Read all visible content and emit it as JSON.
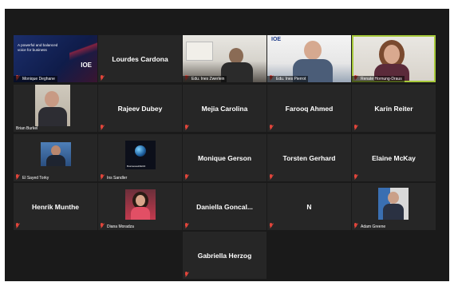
{
  "tiles": [
    {
      "kind": "slide",
      "slide_text": "A powerful and balanced voice for business",
      "slide_logo": "IOE",
      "label": "Monique Deghane"
    },
    {
      "kind": "name",
      "name": "Lourdes Cardona"
    },
    {
      "kind": "video",
      "label": "Edu. Ines Zwerlein"
    },
    {
      "kind": "video",
      "logo": "IOE",
      "label": "Edu. Ines Pierrot"
    },
    {
      "kind": "video",
      "label": "Renate Hornung-Draus",
      "active": true
    },
    {
      "kind": "video",
      "label": "Brian Burkel"
    },
    {
      "kind": "name",
      "name": "Rajeev Dubey"
    },
    {
      "kind": "name",
      "name": "Mejia Carolina"
    },
    {
      "kind": "name",
      "name": "Farooq Ahmed"
    },
    {
      "kind": "name",
      "name": "Karin Reiter"
    },
    {
      "kind": "video",
      "label": "El Sayed Torky"
    },
    {
      "kind": "video",
      "thumb_text": "BusinessatOECD",
      "label": "Ins Sandler"
    },
    {
      "kind": "name",
      "name": "Monique Gerson"
    },
    {
      "kind": "name",
      "name": "Torsten Gerhard"
    },
    {
      "kind": "name",
      "name": "Elaine McKay"
    },
    {
      "kind": "name",
      "name": "Henrik Munthe"
    },
    {
      "kind": "video",
      "label": "Diana Moradza"
    },
    {
      "kind": "name",
      "name": "Daniella Goncal..."
    },
    {
      "kind": "name",
      "name": "N"
    },
    {
      "kind": "video",
      "label": "Adam Greene"
    },
    {
      "kind": "name",
      "name": "Gabriella Herzog"
    }
  ],
  "colors": {
    "background": "#1a1a1a",
    "tile": "#262626",
    "muted_mic": "#e0453b",
    "active_speaker": "#a7c93b"
  },
  "icons": {
    "muted": "muted-mic-icon"
  }
}
